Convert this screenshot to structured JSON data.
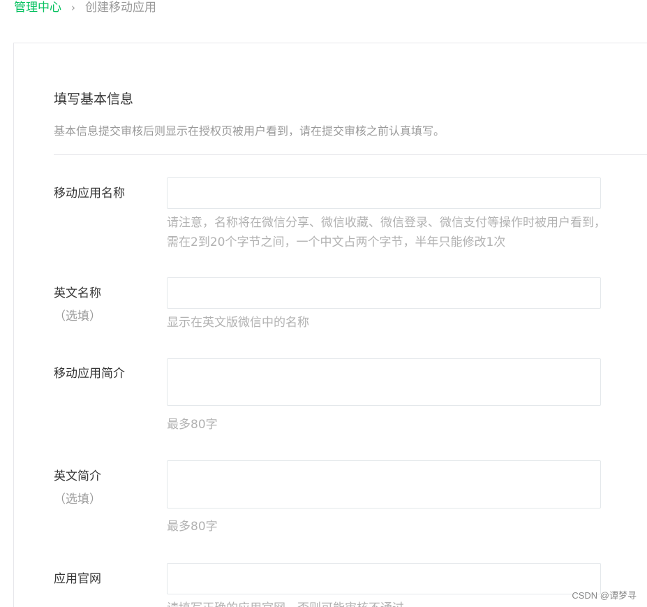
{
  "breadcrumb": {
    "home": "管理中心",
    "separator": ">",
    "current": "创建移动应用"
  },
  "section": {
    "title": "填写基本信息",
    "description": "基本信息提交审核后则显示在授权页被用户看到，请在提交审核之前认真填写。"
  },
  "fields": {
    "app_name": {
      "label": "移动应用名称",
      "value": "",
      "hint_line1": "请注意，名称将在微信分享、微信收藏、微信登录、微信支付等操作时被用户看到，",
      "hint_line2": "需在2到20个字节之间，一个中文占两个字节，半年只能修改1次"
    },
    "english_name": {
      "label": "英文名称",
      "optional": "（选填）",
      "value": "",
      "hint": "显示在英文版微信中的名称"
    },
    "app_intro": {
      "label": "移动应用简介",
      "value": "",
      "hint": "最多80字"
    },
    "english_intro": {
      "label": "英文简介",
      "optional": "（选填）",
      "value": "",
      "hint": "最多80字"
    },
    "website": {
      "label": "应用官网",
      "value": "",
      "hint": "请填写正确的应用官网，否则可能审核不通过"
    }
  },
  "watermark": "CSDN @谭梦寻",
  "colors": {
    "accent": "#07c160",
    "text": "#353535",
    "hint": "#b2b2b2",
    "border": "#e4e8eb"
  }
}
